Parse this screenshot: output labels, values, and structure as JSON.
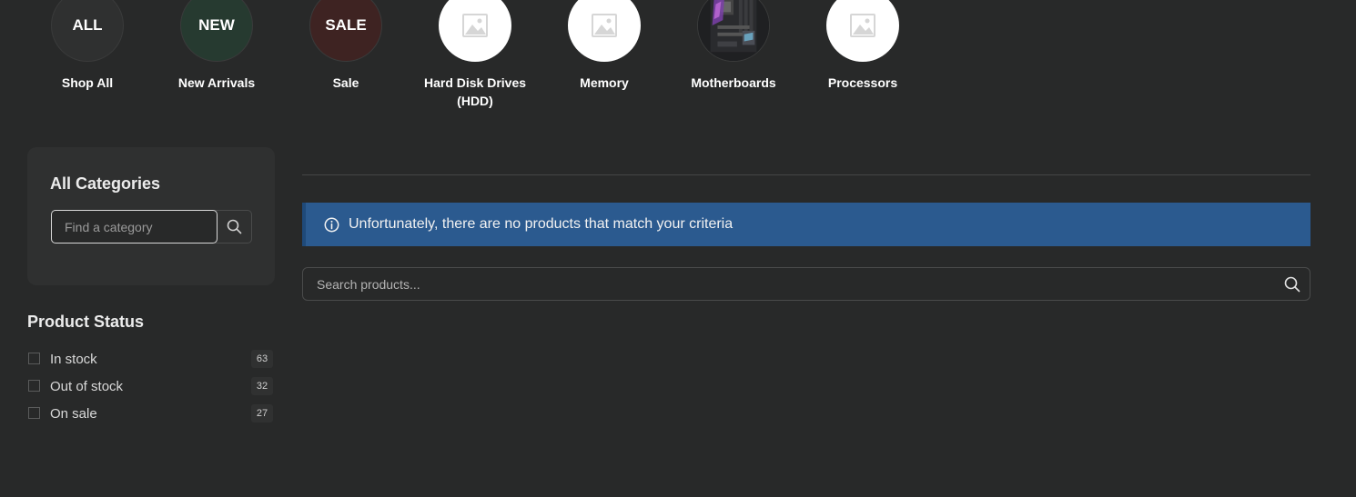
{
  "categories": [
    {
      "badge": "ALL",
      "label": "Shop All",
      "bg": "#2f3030"
    },
    {
      "badge": "NEW",
      "label": "New Arrivals",
      "bg": "#263a30"
    },
    {
      "badge": "SALE",
      "label": "Sale",
      "bg": "#3e2322"
    },
    {
      "badge": "",
      "label": "Hard Disk Drives (HDD)",
      "icon": "image-placeholder-icon"
    },
    {
      "badge": "",
      "label": "Memory",
      "icon": "image-placeholder-icon"
    },
    {
      "badge": "",
      "label": "Motherboards",
      "icon": "motherboard-thumbnail"
    },
    {
      "badge": "",
      "label": "Processors",
      "icon": "image-placeholder-icon"
    }
  ],
  "sidebar": {
    "categories_title": "All Categories",
    "category_search_placeholder": "Find a category",
    "status_title": "Product Status",
    "statuses": [
      {
        "label": "In stock",
        "count": "63"
      },
      {
        "label": "Out of stock",
        "count": "32"
      },
      {
        "label": "On sale",
        "count": "27"
      }
    ]
  },
  "main": {
    "notice_text": "Unfortunately, there are no products that match your criteria",
    "notice_color": "#2b5a8f",
    "search_placeholder": "Search products..."
  }
}
